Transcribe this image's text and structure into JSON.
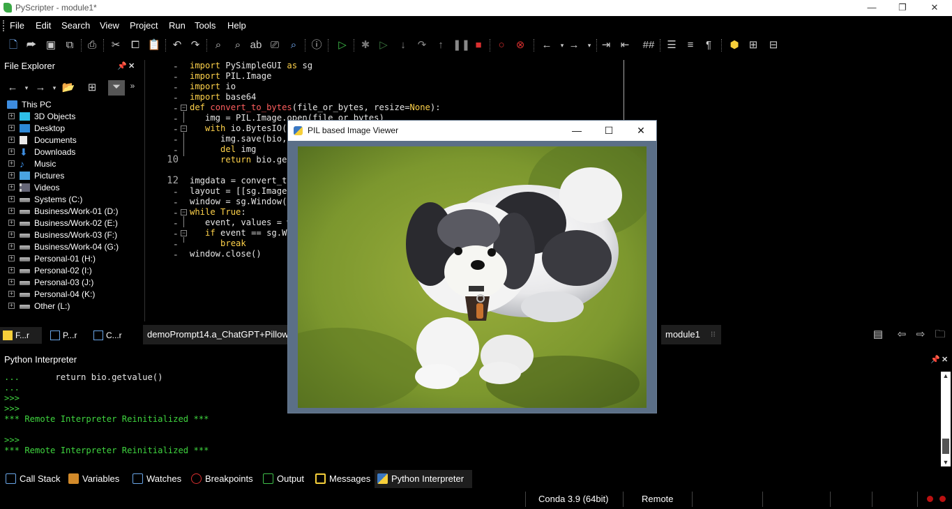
{
  "window": {
    "title": "PyScripter - module1*",
    "minimize": "—",
    "restore": "❐",
    "close": "✕"
  },
  "menu": [
    "File",
    "Edit",
    "Search",
    "View",
    "Project",
    "Run",
    "Tools",
    "Help"
  ],
  "file_explorer": {
    "title": "File Explorer",
    "root": "This PC",
    "items": [
      "3D Objects",
      "Desktop",
      "Documents",
      "Downloads",
      "Music",
      "Pictures",
      "Videos",
      "Systems (C:)",
      "Business/Work-01 (D:)",
      "Business/Work-02 (E:)",
      "Business/Work-03 (F:)",
      "Business/Work-04 (G:)",
      "Personal-01 (H:)",
      "Personal-02 (I:)",
      "Personal-03 (J:)",
      "Personal-04 (K:)",
      "Other (L:)"
    ],
    "tabs": [
      "F...r",
      "P...r",
      "C...r"
    ]
  },
  "editor": {
    "gutter": [
      "-",
      "-",
      "-",
      "-",
      "-",
      "-",
      "-",
      "-",
      "-",
      "10",
      "",
      "12",
      "-",
      "-",
      "-",
      "-",
      "-",
      "-",
      "-",
      "-"
    ],
    "lines": [
      "import PySimpleGUI as sg",
      "import PIL.Image",
      "import io",
      "import base64",
      "def convert_to_bytes(file_or_bytes, resize=None):",
      "   img = PIL.Image.open(file_or_bytes)",
      "   with io.BytesIO() as bio:",
      "      img.save(bio,",
      "      del img",
      "      return bio.get",
      "",
      "imgdata = convert_to",
      "layout = [[sg.Image(",
      "window = sg.Window('",
      "while True:",
      "   event, values = w",
      "   if event == sg.WI",
      "      break",
      "window.close()"
    ],
    "tabs": [
      "demoPrompt14.a_ChatGPT+Pillow.",
      "module1"
    ]
  },
  "interpreter": {
    "title": "Python Interpreter",
    "lines": [
      "...       return bio.getvalue()",
      "...",
      ">>>",
      ">>>",
      "*** Remote Interpreter Reinitialized ***",
      "",
      ">>>",
      "*** Remote Interpreter Reinitialized ***"
    ]
  },
  "bottom_tabs": [
    "Call Stack",
    "Variables",
    "Watches",
    "Breakpoints",
    "Output",
    "Messages",
    "Python Interpreter"
  ],
  "status": {
    "env": "Conda 3.9 (64bit)",
    "mode": "Remote"
  },
  "viewer": {
    "title": "PIL based Image Viewer"
  },
  "colors": {
    "keyword": "#ffd24a",
    "function": "#ff5e5e",
    "prompt": "#3fd43f",
    "viewer_frame": "#5b6f87"
  }
}
